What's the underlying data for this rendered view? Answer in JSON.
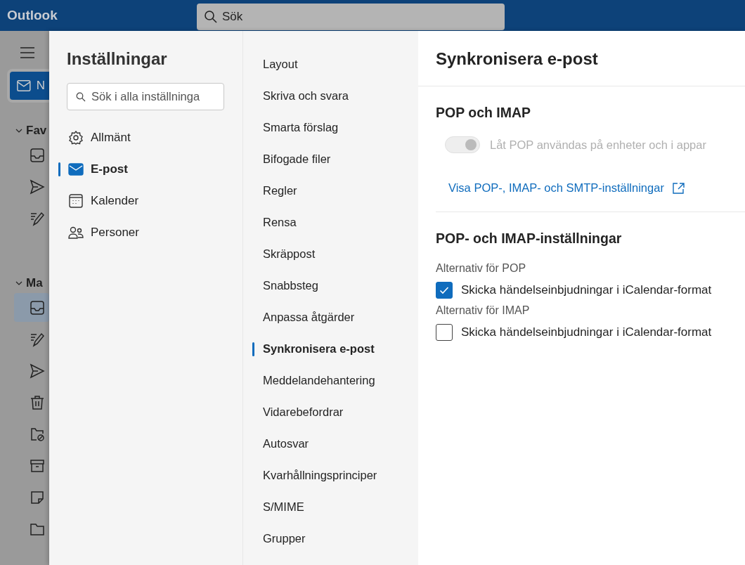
{
  "app": {
    "title": "Outlook",
    "search": {
      "placeholder": "Sök"
    },
    "new_button": "N",
    "groups": [
      {
        "label": "Fav",
        "expanded": true,
        "folders": [
          {
            "kind": "inbox",
            "selected": false
          },
          {
            "kind": "sent",
            "selected": false
          },
          {
            "kind": "drafts",
            "selected": false
          }
        ]
      },
      {
        "label": "Ma",
        "expanded": true,
        "folders": [
          {
            "kind": "inbox",
            "selected": true
          },
          {
            "kind": "drafts",
            "selected": false
          },
          {
            "kind": "sent",
            "selected": false
          },
          {
            "kind": "trash",
            "selected": false
          },
          {
            "kind": "junk",
            "selected": false
          },
          {
            "kind": "archive",
            "selected": false
          },
          {
            "kind": "note",
            "selected": false
          },
          {
            "kind": "folder",
            "selected": false
          }
        ]
      }
    ]
  },
  "settings": {
    "title": "Inställningar",
    "search": {
      "placeholder": "Sök i alla inställninga"
    },
    "categories": [
      {
        "kind": "gear",
        "label": "Allmänt",
        "selected": false
      },
      {
        "kind": "mail",
        "label": "E-post",
        "selected": true
      },
      {
        "kind": "calendar",
        "label": "Kalender",
        "selected": false
      },
      {
        "kind": "people",
        "label": "Personer",
        "selected": false
      }
    ],
    "subnav": [
      {
        "label": "Layout",
        "selected": false
      },
      {
        "label": "Skriva och svara",
        "selected": false
      },
      {
        "label": "Smarta förslag",
        "selected": false
      },
      {
        "label": "Bifogade filer",
        "selected": false
      },
      {
        "label": "Regler",
        "selected": false
      },
      {
        "label": "Rensa",
        "selected": false
      },
      {
        "label": "Skräppost",
        "selected": false
      },
      {
        "label": "Snabbsteg",
        "selected": false
      },
      {
        "label": "Anpassa åtgärder",
        "selected": false
      },
      {
        "label": "Synkronisera e-post",
        "selected": true
      },
      {
        "label": "Meddelandehantering",
        "selected": false
      },
      {
        "label": "Vidarebefordrar",
        "selected": false
      },
      {
        "label": "Autosvar",
        "selected": false
      },
      {
        "label": "Kvarhållningsprinciper",
        "selected": false
      },
      {
        "label": "S/MIME",
        "selected": false
      },
      {
        "label": "Grupper",
        "selected": false
      }
    ],
    "page": {
      "title": "Synkronisera e-post",
      "section_1": {
        "title": "POP och IMAP",
        "toggle": {
          "label": "Låt POP användas på enheter och i appar",
          "on": true,
          "disabled": true
        },
        "link": "Visa POP-, IMAP- och SMTP-inställningar"
      },
      "section_2": {
        "title": "POP- och IMAP-inställningar",
        "groups": [
          {
            "label": "Alternativ för POP",
            "checkbox": {
              "label": "Skicka händelseinbjudningar i iCalendar-format",
              "checked": true
            }
          },
          {
            "label": "Alternativ för IMAP",
            "checkbox": {
              "label": "Skicka händelseinbjudningar i iCalendar-format",
              "checked": false
            }
          }
        ]
      }
    }
  }
}
